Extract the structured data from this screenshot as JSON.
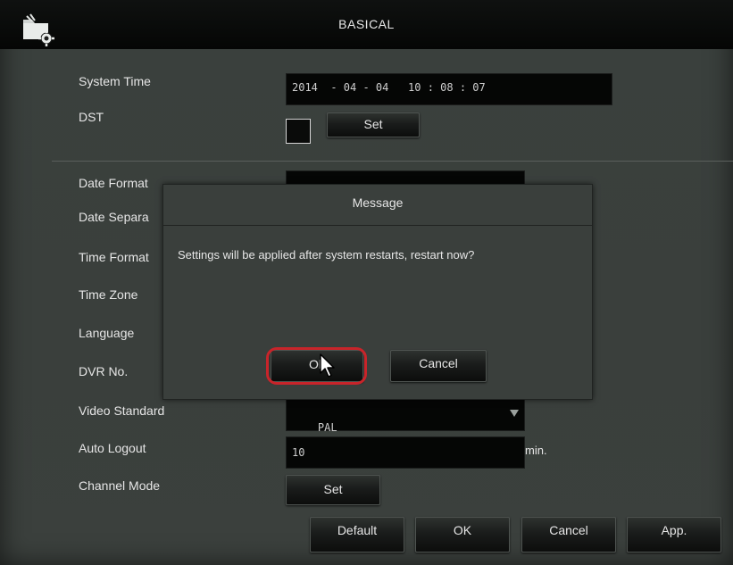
{
  "window": {
    "title": "BASICAL",
    "icon": "settings-folder-gear-icon"
  },
  "fields": {
    "system_time": {
      "label": "System Time",
      "value": "2014  - 04 - 04   10 : 08 : 07"
    },
    "dst": {
      "label": "DST",
      "set_label": "Set"
    },
    "date_format": {
      "label": "Date Format"
    },
    "date_separator": {
      "label": "Date Separa"
    },
    "time_format": {
      "label": "Time Format"
    },
    "time_zone": {
      "label": "Time Zone"
    },
    "language": {
      "label": "Language"
    },
    "dvr_no": {
      "label": "DVR No."
    },
    "video_standard": {
      "label": "Video Standard",
      "value": "PAL"
    },
    "auto_logout": {
      "label": "Auto Logout",
      "value": "10",
      "unit": "min."
    },
    "channel_mode": {
      "label": "Channel Mode",
      "set_label": "Set"
    }
  },
  "footer": {
    "default_label": "Default",
    "ok_label": "OK",
    "cancel_label": "Cancel",
    "apply_label": "App."
  },
  "dialog": {
    "title": "Message",
    "message": "Settings will be applied after system restarts, restart now?",
    "ok_label": "Ok",
    "cancel_label": "Cancel",
    "highlight_color": "#c8242a"
  }
}
